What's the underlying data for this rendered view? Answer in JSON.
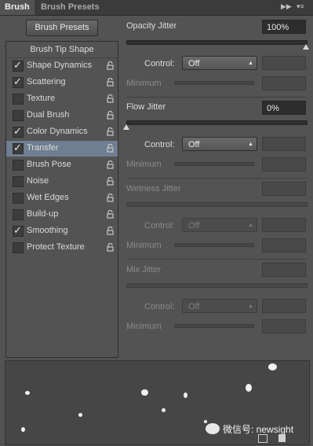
{
  "tabs": [
    "Brush",
    "Brush Presets"
  ],
  "tab_icons": [
    "double-arrow-icon",
    "panel-menu-icon"
  ],
  "presets_button": "Brush Presets",
  "tip_shape": "Brush Tip Shape",
  "list": [
    {
      "label": "Shape Dynamics",
      "checked": true
    },
    {
      "label": "Scattering",
      "checked": true
    },
    {
      "label": "Texture",
      "checked": false
    },
    {
      "label": "Dual Brush",
      "checked": false
    },
    {
      "label": "Color Dynamics",
      "checked": true
    },
    {
      "label": "Transfer",
      "checked": true,
      "selected": true
    },
    {
      "label": "Brush Pose",
      "checked": false
    },
    {
      "label": "Noise",
      "checked": false
    },
    {
      "label": "Wet Edges",
      "checked": false
    },
    {
      "label": "Build-up",
      "checked": false
    },
    {
      "label": "Smoothing",
      "checked": true
    },
    {
      "label": "Protect Texture",
      "checked": false
    }
  ],
  "check_glyph": "✓",
  "opacity": {
    "label": "Opacity Jitter",
    "value": "100%",
    "level": 1.0,
    "control_label": "Control:",
    "control": "Off",
    "minimum_label": "Minimum"
  },
  "flow": {
    "label": "Flow Jitter",
    "value": "0%",
    "level": 0.0,
    "control_label": "Control:",
    "control": "Off",
    "minimum_label": "Minimum"
  },
  "wetness": {
    "label": "Wetness Jitter",
    "control_label": "Control:",
    "control": "Off",
    "minimum_label": "Minimum"
  },
  "mix": {
    "label": "Mix Jitter",
    "control_label": "Control:",
    "control": "Off",
    "minimum_label": "Minimum"
  },
  "watermark": "微信号: newsight",
  "colors": {
    "panel": "#535353",
    "selected_row": "#6f7e91",
    "tabbar": "#3b3b3b"
  }
}
